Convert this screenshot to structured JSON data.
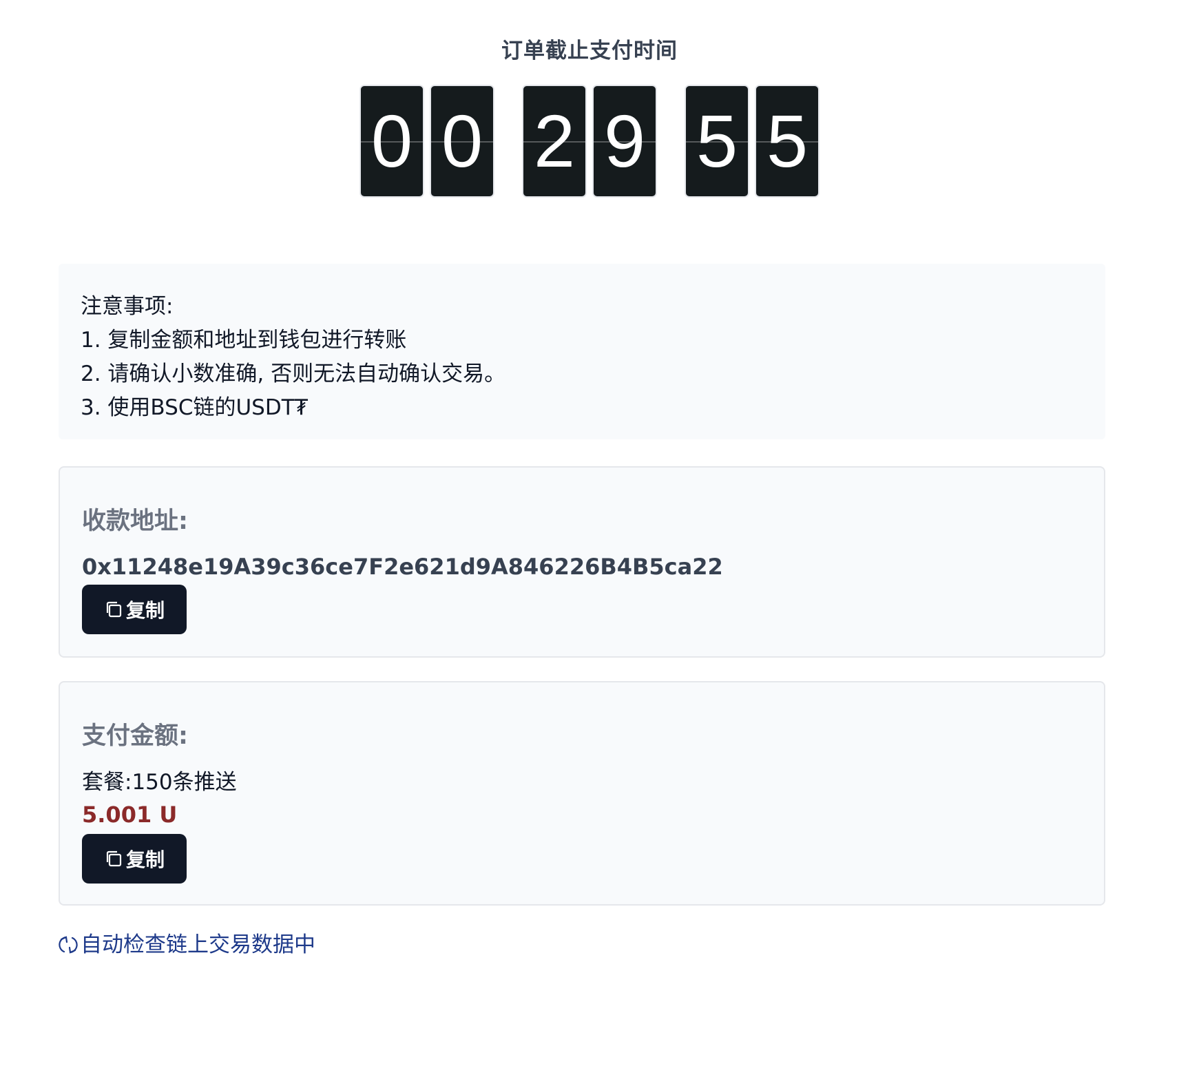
{
  "countdown": {
    "title": "订单截止支付时间",
    "hours": [
      "0",
      "0"
    ],
    "minutes": [
      "2",
      "9"
    ],
    "seconds": [
      "5",
      "5"
    ]
  },
  "notice": {
    "heading": "注意事项:",
    "items": [
      "1. 复制金额和地址到钱包进行转账",
      "2. 请确认小数准确, 否则无法自动确认交易。",
      "3. 使用BSC链的USDT₮"
    ]
  },
  "address_card": {
    "label": "收款地址:",
    "address": "0x11248e19A39c36ce7F2e621d9A846226B4B5ca22",
    "copy_label": "复制"
  },
  "amount_card": {
    "label": "支付金额:",
    "package": "套餐:150条推送",
    "amount": "5.001 U",
    "copy_label": "复制"
  },
  "status": {
    "text": "自动检查链上交易数据中"
  },
  "colors": {
    "digit_bg": "#151b1d",
    "button_bg": "#111827",
    "amount": "#8b2a2a",
    "status": "#1e3a8a",
    "panel_bg": "#f8fafc"
  },
  "icons": {
    "copy": "copy-icon",
    "refresh": "refresh-icon"
  }
}
